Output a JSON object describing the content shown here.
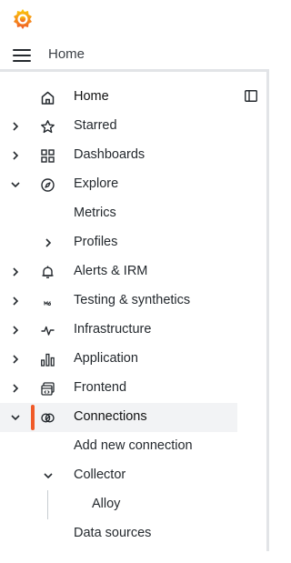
{
  "app": {
    "logo_icon": "grafana-logo-icon",
    "accent": "#f05a28"
  },
  "topbar": {
    "breadcrumb": "Home",
    "menu_icon": "hamburger-menu-icon"
  },
  "nav": {
    "home": {
      "label": "Home",
      "icon": "home-icon"
    },
    "dock_icon": "dock-menu-icon",
    "starred": {
      "label": "Starred",
      "icon": "star-icon",
      "expanded": false
    },
    "dashboards": {
      "label": "Dashboards",
      "icon": "dashboards-grid-icon",
      "expanded": false
    },
    "explore": {
      "label": "Explore",
      "icon": "compass-icon",
      "expanded": true,
      "children": {
        "metrics": "Metrics",
        "profiles": "Profiles"
      }
    },
    "alerts": {
      "label": "Alerts & IRM",
      "icon": "bell-icon",
      "expanded": false
    },
    "testing": {
      "label": "Testing & synthetics",
      "icon": "k6-icon",
      "expanded": false
    },
    "infrastructure": {
      "label": "Infrastructure",
      "icon": "heartbeat-icon",
      "expanded": false
    },
    "application": {
      "label": "Application",
      "icon": "bar-chart-icon",
      "expanded": false
    },
    "frontend": {
      "label": "Frontend",
      "icon": "frontend-icon",
      "expanded": false
    },
    "connections": {
      "label": "Connections",
      "icon": "connections-icon",
      "expanded": true,
      "active": true,
      "children": {
        "add_new": "Add new connection",
        "collector": {
          "label": "Collector",
          "expanded": true,
          "children": {
            "alloy": "Alloy"
          }
        },
        "data_sources": "Data sources"
      }
    }
  }
}
